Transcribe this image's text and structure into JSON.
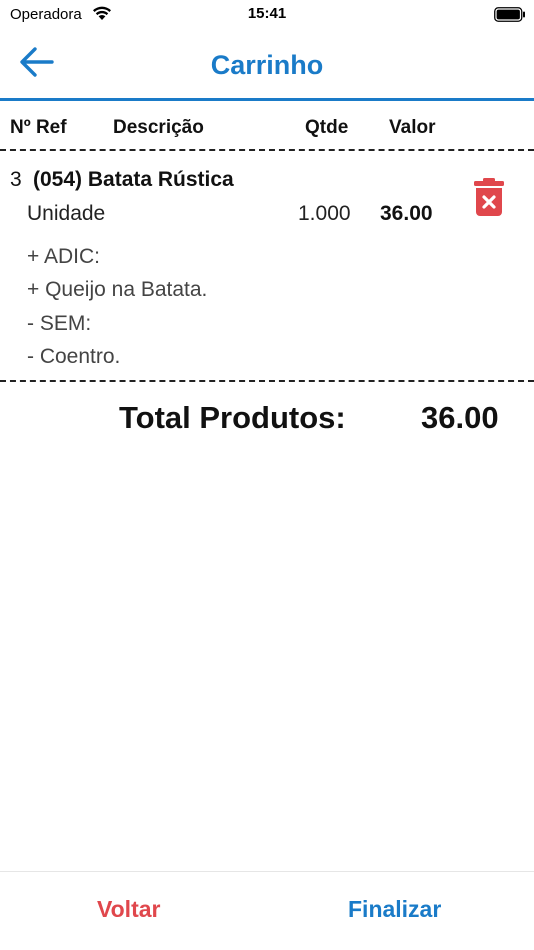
{
  "status_bar": {
    "carrier": "Operadora",
    "time": "15:41"
  },
  "header": {
    "title": "Carrinho",
    "back_icon": "arrow-left-icon"
  },
  "table": {
    "columns": [
      "Nº Ref",
      "Descrição",
      "Qtde",
      "Valor"
    ],
    "items": [
      {
        "ref": "3",
        "name": "(054) Batata Rústica",
        "unit": "Unidade",
        "qty": "1.000",
        "value": "36.00",
        "modifiers": [
          "+ ADIC:",
          "+ Queijo na Batata.",
          "- SEM:",
          "- Coentro."
        ]
      }
    ]
  },
  "total": {
    "label": "Total Produtos:",
    "value": "36.00"
  },
  "footer": {
    "back_label": "Voltar",
    "finish_label": "Finalizar"
  },
  "colors": {
    "accent": "#1a7bc8",
    "danger": "#e0474c"
  }
}
